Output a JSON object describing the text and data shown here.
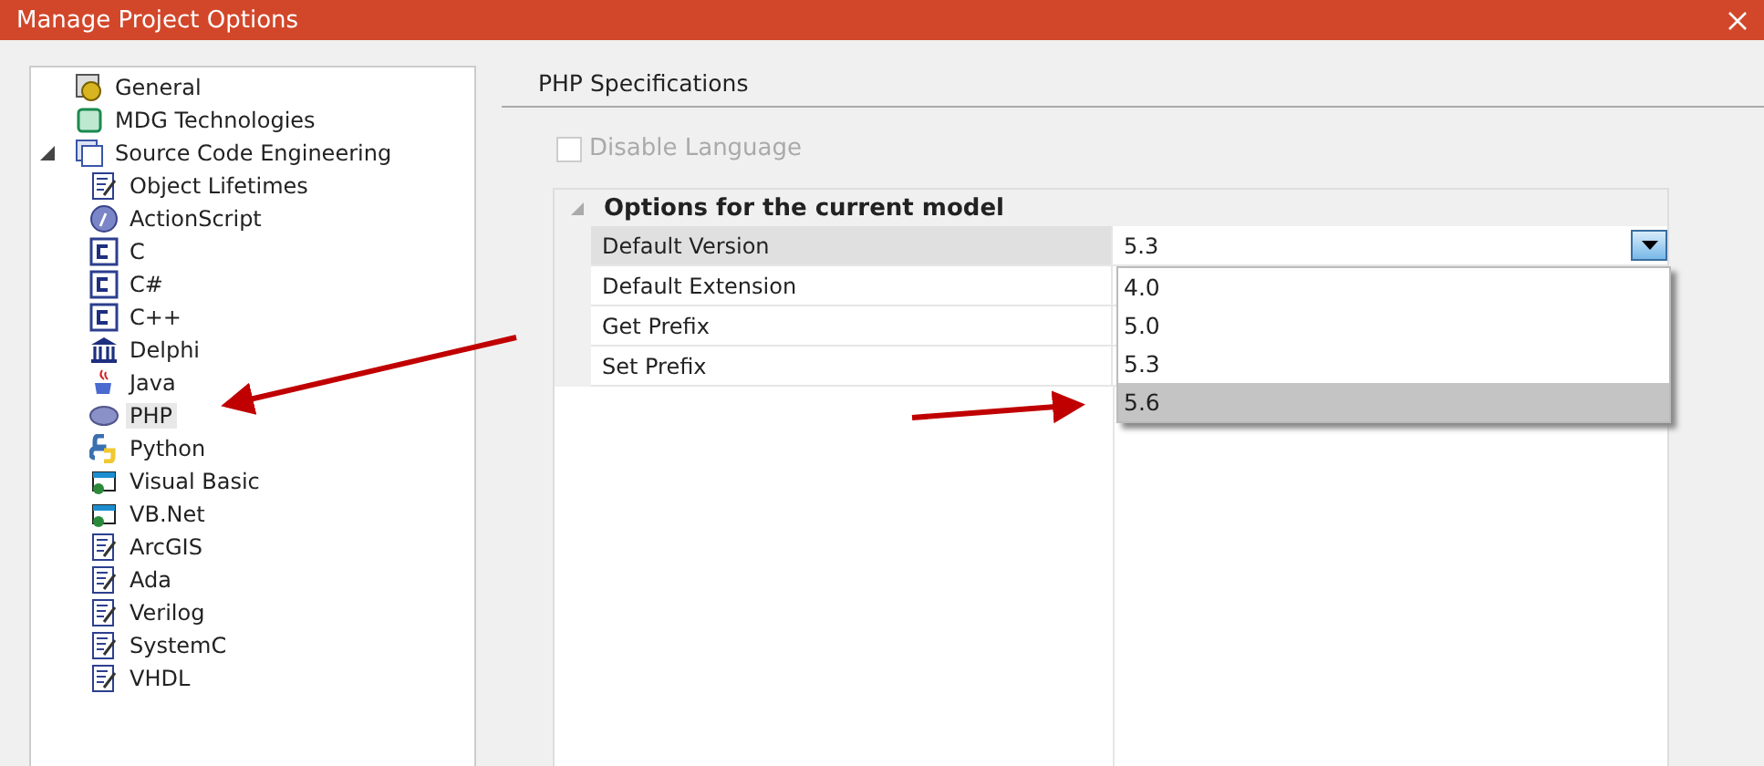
{
  "window": {
    "title": "Manage Project Options"
  },
  "tree": {
    "items": [
      {
        "label": "General",
        "kind": "gear",
        "selected": false
      },
      {
        "label": "MDG Technologies",
        "kind": "mdg",
        "selected": false
      },
      {
        "label": "Source Code Engineering",
        "kind": "stack",
        "selected": false,
        "expanded": true,
        "children": [
          {
            "label": "Object Lifetimes",
            "kind": "doc",
            "selected": false
          },
          {
            "label": "ActionScript",
            "kind": "disc",
            "selected": false
          },
          {
            "label": "C",
            "kind": "c",
            "selected": false
          },
          {
            "label": "C#",
            "kind": "c",
            "selected": false
          },
          {
            "label": "C++",
            "kind": "c",
            "selected": false
          },
          {
            "label": "Delphi",
            "kind": "temple",
            "selected": false
          },
          {
            "label": "Java",
            "kind": "cup",
            "selected": false
          },
          {
            "label": "PHP",
            "kind": "oval",
            "selected": true
          },
          {
            "label": "Python",
            "kind": "snake",
            "selected": false
          },
          {
            "label": "Visual Basic",
            "kind": "vb",
            "selected": false
          },
          {
            "label": "VB.Net",
            "kind": "vb",
            "selected": false
          },
          {
            "label": "ArcGIS",
            "kind": "doc",
            "selected": false
          },
          {
            "label": "Ada",
            "kind": "doc",
            "selected": false
          },
          {
            "label": "Verilog",
            "kind": "doc",
            "selected": false
          },
          {
            "label": "SystemC",
            "kind": "doc",
            "selected": false
          },
          {
            "label": "VHDL",
            "kind": "doc",
            "selected": false
          }
        ]
      }
    ]
  },
  "panel": {
    "heading": "PHP Specifications",
    "disable_language": {
      "label": "Disable Language",
      "checked": false,
      "disabled": true
    },
    "grid": {
      "group": "Options for the current model",
      "expanded": true,
      "rows": [
        {
          "name": "Default Version",
          "value": "5.3",
          "selected": true
        },
        {
          "name": "Default Extension",
          "selected": false
        },
        {
          "name": "Get Prefix",
          "selected": false
        },
        {
          "name": "Set Prefix",
          "selected": false
        }
      ],
      "dropdown_options": [
        {
          "label": "4.0",
          "selected": false
        },
        {
          "label": "5.0",
          "selected": false
        },
        {
          "label": "5.3",
          "selected": false
        },
        {
          "label": "5.6",
          "selected": true
        }
      ]
    }
  }
}
